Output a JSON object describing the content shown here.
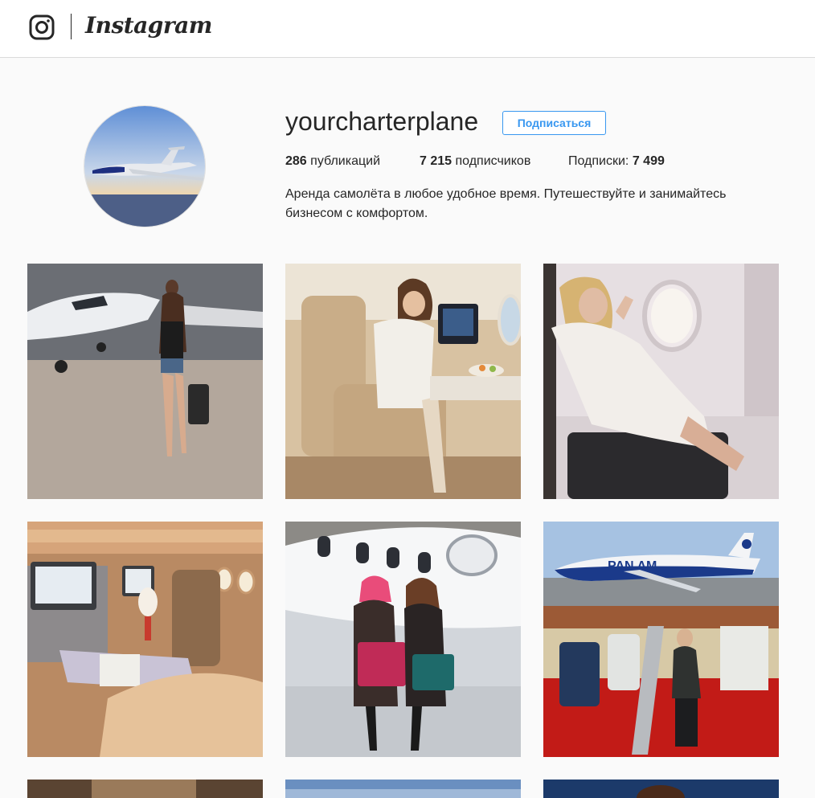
{
  "header": {
    "logo_icon": "instagram-camera-icon",
    "logo_text": "Instagram"
  },
  "profile": {
    "avatar_icon": "jet-avatar",
    "username": "yourcharterplane",
    "follow_label": "Подписаться",
    "stats": [
      {
        "value": "286",
        "label": "публикаций"
      },
      {
        "value": "7 215",
        "label": "подписчиков"
      },
      {
        "label": "Подписки:",
        "value": "7 499"
      }
    ],
    "bio": "Аренда самолёта в любое удобное время. Путешествуйте и занимайтесь бизнесом с комфортом."
  },
  "posts": [
    {
      "subject": "woman-with-jet-hangar"
    },
    {
      "subject": "woman-in-cabin-seat"
    },
    {
      "subject": "woman-by-window"
    },
    {
      "subject": "first-class-cabin"
    },
    {
      "subject": "two-women-by-jet"
    },
    {
      "subject": "panam-747-collage"
    },
    {
      "subject": "partial-post"
    },
    {
      "subject": "partial-post"
    },
    {
      "subject": "partial-post"
    }
  ],
  "colors": {
    "accent": "#3897f0",
    "text": "#262626",
    "background": "#fafafa",
    "border": "#dbdbdb"
  }
}
